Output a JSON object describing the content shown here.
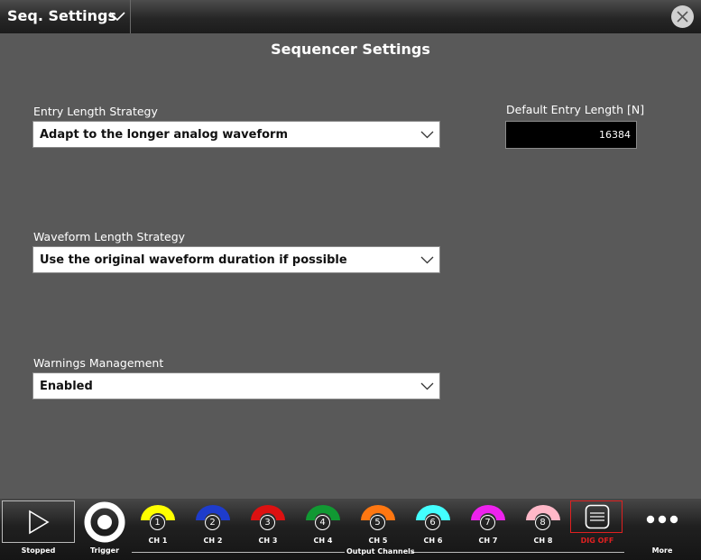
{
  "header": {
    "title": "Seq. Settings"
  },
  "page_title": "Sequencer Settings",
  "entry_length_strategy": {
    "label": "Entry Length Strategy",
    "value": "Adapt to the longer analog waveform"
  },
  "default_entry_length": {
    "label": "Default Entry Length [N]",
    "value": "16384"
  },
  "waveform_length_strategy": {
    "label": "Waveform Length Strategy",
    "value": "Use the original waveform duration if possible"
  },
  "warnings_management": {
    "label": "Warnings Management",
    "value": "Enabled"
  },
  "bottom": {
    "play_label": "Stopped",
    "trigger_label": "Trigger",
    "dig_label": "DIG OFF",
    "output_channels_label": "Output Channels",
    "more_label": "More",
    "channels": [
      {
        "num": "1",
        "label": "CH 1",
        "color": "#ffff00"
      },
      {
        "num": "2",
        "label": "CH 2",
        "color": "#1e3ccc"
      },
      {
        "num": "3",
        "label": "CH 3",
        "color": "#dd1111"
      },
      {
        "num": "4",
        "label": "CH 4",
        "color": "#119933"
      },
      {
        "num": "5",
        "label": "CH 5",
        "color": "#ff7711"
      },
      {
        "num": "6",
        "label": "CH 6",
        "color": "#44ffff"
      },
      {
        "num": "7",
        "label": "CH 7",
        "color": "#ee22ee"
      },
      {
        "num": "8",
        "label": "CH 8",
        "color": "#ffb8c8"
      }
    ]
  }
}
